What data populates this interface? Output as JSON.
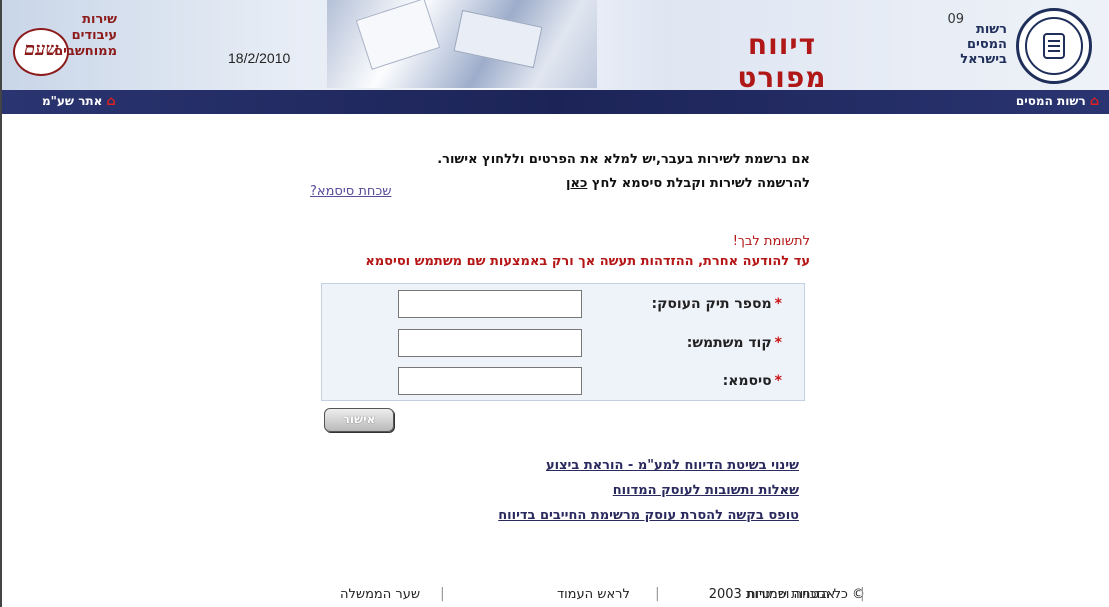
{
  "header": {
    "agency_lines": [
      "רשות",
      "המסים",
      "בישראל"
    ],
    "agency_num": "09",
    "title": "דיווח מפורט",
    "date": "18/2/2010",
    "sherut_lines": [
      "שירות",
      "עיבודים",
      "ממוחשבים"
    ],
    "logo_left_text": "שעם"
  },
  "nav": {
    "right_link": "רשות המסים",
    "left_link": "אתר שע\"מ"
  },
  "content": {
    "line1": "אם נרשמת לשירות בעבר,יש למלא את הפרטים וללחוץ אישור.",
    "line2_prefix": "להרשמה לשירות וקבלת סיסמא לחץ",
    "line2_link": "כאן",
    "forgot": "שכחת סיסמא?",
    "attention": "לתשומת לבך!",
    "attention2": "עד להודעה אחרת, ההזדהות תעשה אך ורק באמצעות שם משתמש וסיסמא"
  },
  "form": {
    "fields": [
      {
        "label": "מספר תיק העוסק:",
        "value": ""
      },
      {
        "label": "קוד משתמש:",
        "value": ""
      },
      {
        "label": "סיסמא:",
        "value": ""
      }
    ],
    "required_mark": "*",
    "submit": "אישור"
  },
  "links": [
    "שינוי בשיטת הדיווח למע\"מ - הוראת ביצוע",
    "שאלות ותשובות לעוסק המדווח",
    "טופס בקשה להסרת עוסק מרשימת החייבים בדיווח"
  ],
  "footer": {
    "copyright": "© כל הזכויות שמורות 2003",
    "privacy": "אבטחה ופרטיות",
    "top": "לראש העמוד",
    "gov": "שער הממשלה"
  },
  "colors": {
    "navbar": "#1c2457",
    "title": "#b01818",
    "attention": "#b51616"
  }
}
